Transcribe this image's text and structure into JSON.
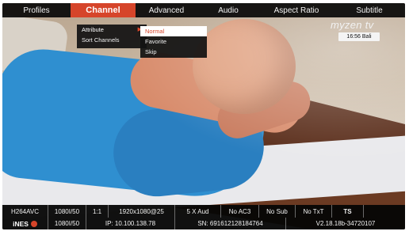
{
  "menu": {
    "tabs": [
      {
        "label": "Profiles"
      },
      {
        "label": "Channel"
      },
      {
        "label": "Advanced"
      },
      {
        "label": "Audio"
      },
      {
        "label": "Aspect Ratio"
      },
      {
        "label": "Subtitle"
      }
    ],
    "active_tab": "Channel"
  },
  "channel_menu": {
    "items": [
      {
        "label": "Attribute"
      },
      {
        "label": "Sort Channels"
      }
    ]
  },
  "attribute_submenu": {
    "items": [
      {
        "label": "Normal"
      },
      {
        "label": "Favorite"
      },
      {
        "label": "Skip"
      }
    ],
    "selected": "Normal"
  },
  "brand": {
    "name": "myzen tv",
    "clock": "16:56 Bali"
  },
  "info_bar": {
    "codec": "H264AVC",
    "mode": "1080I/50",
    "ratio": "1:1",
    "resolution": "1920x1080@25",
    "audio": "5 X Aud",
    "ac3": "No AC3",
    "subtitle": "No Sub",
    "teletext": "No TxT",
    "stream": "TS"
  },
  "status_bar": {
    "logo": "iNES",
    "mode": "1080I/50",
    "ip": "IP: 10.100.138.78",
    "serial": "SN: 691612128184764",
    "version": "V2.18.18b-34720107"
  },
  "colors": {
    "accent": "#d6452a",
    "bar_bg": "#050505"
  },
  "icons": {
    "submenu_arrow": "chevron-right-icon",
    "logo_mark": "ines-logo-icon"
  }
}
